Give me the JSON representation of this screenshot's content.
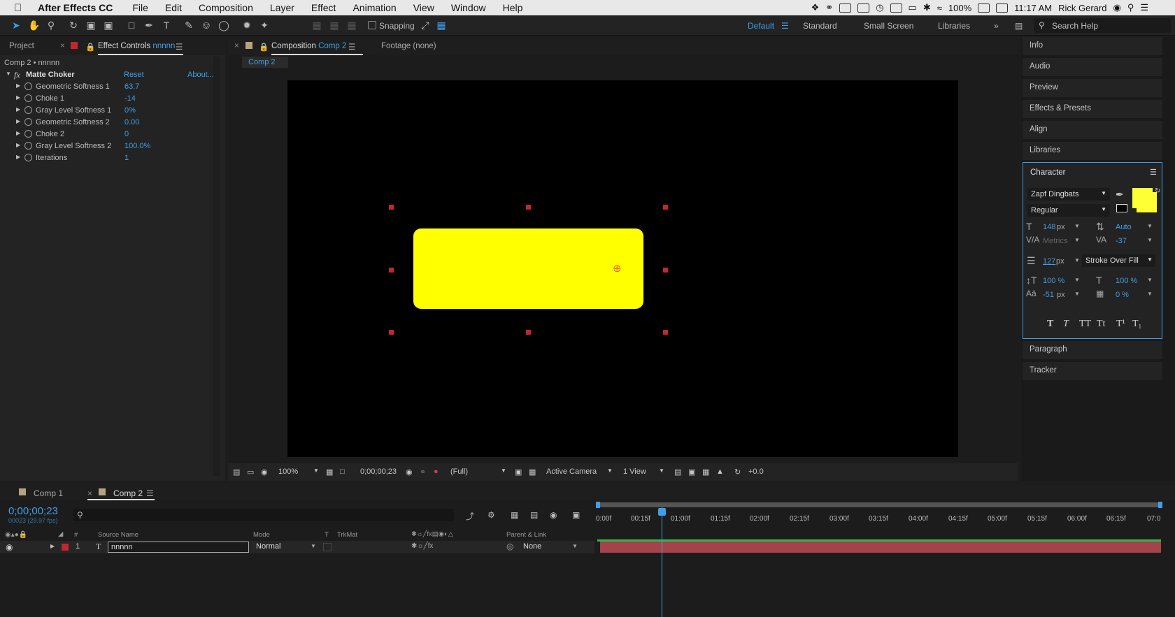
{
  "menubar": {
    "app_name": "After Effects CC",
    "items": [
      "File",
      "Edit",
      "Composition",
      "Layer",
      "Effect",
      "Animation",
      "View",
      "Window",
      "Help"
    ],
    "battery": "100%",
    "time": "11:17 AM",
    "user": "Rick Gerard"
  },
  "toolbar": {
    "snapping": "Snapping",
    "workspaces": [
      "Default",
      "Standard",
      "Small Screen",
      "Libraries"
    ],
    "search_placeholder": "Search Help"
  },
  "left_panel": {
    "tab_project": "Project",
    "tab_effect_controls": "Effect Controls",
    "effect_layer": "nnnnn",
    "breadcrumb": "Comp 2 • nnnnn",
    "effect_name": "Matte Choker",
    "reset": "Reset",
    "about": "About...",
    "properties": [
      {
        "name": "Geometric Softness 1",
        "value": "63.7"
      },
      {
        "name": "Choke 1",
        "value": "-14"
      },
      {
        "name": "Gray Level Softness 1",
        "value": "0%"
      },
      {
        "name": "Geometric Softness 2",
        "value": "0.00"
      },
      {
        "name": "Choke 2",
        "value": "0"
      },
      {
        "name": "Gray Level Softness 2",
        "value": "100.0%"
      },
      {
        "name": "Iterations",
        "value": "1"
      }
    ]
  },
  "comp_panel": {
    "tab_composition": "Composition",
    "comp_name": "Comp 2",
    "tab_footage": "Footage (none)",
    "sub_tab": "Comp 2",
    "zoom": "100%",
    "timecode": "0;00;00;23",
    "resolution": "(Full)",
    "camera": "Active Camera",
    "views": "1 View",
    "exposure": "+0.0",
    "shape_color": "#ffff00"
  },
  "right_panels": {
    "items": [
      "Info",
      "Audio",
      "Preview",
      "Effects & Presets",
      "Align",
      "Libraries"
    ],
    "character_title": "Character",
    "bottom_items": [
      "Paragraph",
      "Tracker"
    ]
  },
  "character": {
    "font": "Zapf Dingbats",
    "style": "Regular",
    "font_size": "148",
    "font_size_unit": "px",
    "leading": "Auto",
    "kerning": "Metrics",
    "tracking": "-37",
    "stroke_width": "127",
    "stroke_unit": "px",
    "stroke_mode": "Stroke Over Fill",
    "vscale": "100 %",
    "hscale": "100 %",
    "baseline": "-51",
    "baseline_unit": "px",
    "tsume": "0 %",
    "fill_color": "#ffff33",
    "style_buttons": [
      "T",
      "T",
      "TT",
      "Tt",
      "T¹",
      "T₁"
    ]
  },
  "timeline": {
    "tab_comp1": "Comp 1",
    "tab_comp2": "Comp 2",
    "timecode": "0;00;00;23",
    "fps": "00023 (29.97 fps)",
    "col_source": "Source Name",
    "col_mode": "Mode",
    "col_t": "T",
    "col_trkmat": "TrkMat",
    "col_parent": "Parent & Link",
    "col_num": "#",
    "layer_num": "1",
    "layer_name": "nnnnn",
    "layer_mode": "Normal",
    "layer_parent": "None",
    "ruler": [
      "0:00f",
      "00:15f",
      "01:00f",
      "01:15f",
      "02:00f",
      "02:15f",
      "03:00f",
      "03:15f",
      "04:00f",
      "04:15f",
      "05:00f",
      "05:15f",
      "06:00f",
      "06:15f",
      "07:0"
    ]
  }
}
